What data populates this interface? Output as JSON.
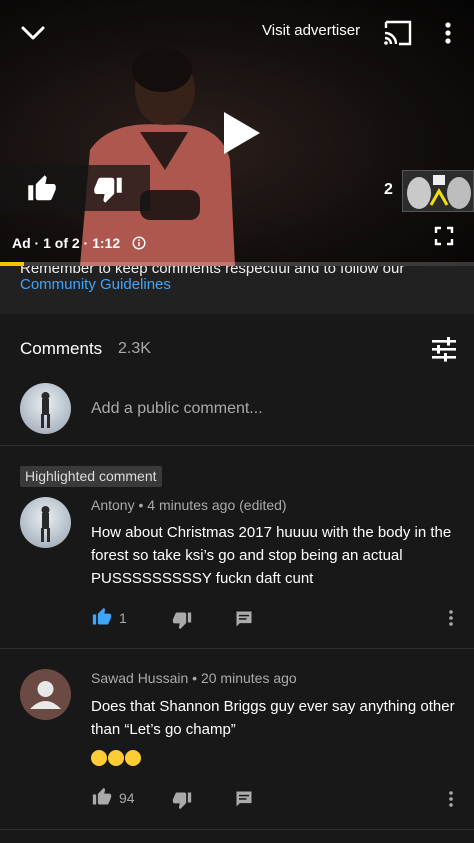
{
  "player": {
    "visit_advertiser": "Visit advertiser",
    "ad_info": "Ad · 1 of 2 · 1:12",
    "skip_countdown": "2",
    "progress": 0.05,
    "accent_color": "#f3c400",
    "icons": [
      "chevron-down-icon",
      "cast-icon",
      "more-vert-icon",
      "play-icon",
      "thumbs-up-icon",
      "thumbs-down-icon",
      "info-icon",
      "fullscreen-icon"
    ]
  },
  "guidelines": {
    "text": "Remember to keep comments respectful and to follow our",
    "link": "Community Guidelines",
    "link_color": "#3ea6ff"
  },
  "comments": {
    "title": "Comments",
    "count": "2.3K",
    "add_placeholder": "Add a public comment...",
    "highlighted_label": "Highlighted comment",
    "items": [
      {
        "author": "Antony",
        "time": "4 minutes ago (edited)",
        "text": "How about Christmas 2017 huuuu with the body in the forest so take ksi’s go and stop being an actual PUSSSSSSSSSY fuckn daft cunt",
        "likes": "1",
        "liked": true
      },
      {
        "author": "Sawad Hussain",
        "time": "20 minutes ago",
        "text": "Does that Shannon Briggs guy ever say anything other than “Let’s go champ”",
        "emoji_count": 3,
        "likes": "94",
        "liked": false
      }
    ]
  }
}
